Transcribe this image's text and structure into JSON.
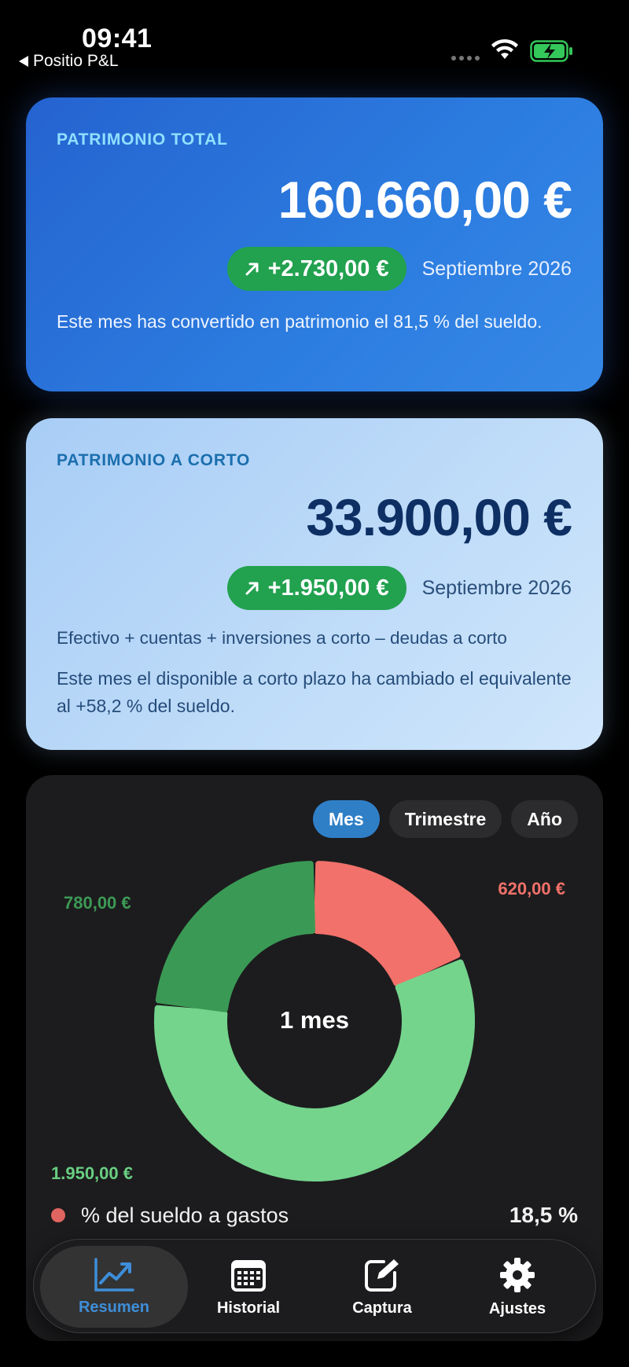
{
  "status": {
    "time": "09:41",
    "back_app": "Positio P&L"
  },
  "total": {
    "label": "PATRIMONIO TOTAL",
    "amount": "160.660,00 €",
    "delta": "+2.730,00 €",
    "period": "Septiembre 2026",
    "note": "Este mes has convertido en patrimonio el 81,5 % del sueldo."
  },
  "short": {
    "label": "PATRIMONIO A CORTO",
    "amount": "33.900,00 €",
    "delta": "+1.950,00 €",
    "period": "Septiembre 2026",
    "formula": "Efectivo + cuentas + inversiones a corto – deudas a corto",
    "note": "Este mes el disponible a corto plazo ha cambiado el equivalente al +58,2 % del sueldo."
  },
  "chart": {
    "segments": [
      "Mes",
      "Trimestre",
      "Año"
    ],
    "selected": "Mes",
    "center_label": "1 mes",
    "slices": [
      {
        "label": "620,00 €",
        "value": 620,
        "color": "#f2716a"
      },
      {
        "label": "1.950,00 €",
        "value": 1950,
        "color": "#74d48c"
      },
      {
        "label": "780,00 €",
        "value": 780,
        "color": "#3a9a55"
      }
    ],
    "legend": {
      "label": "% del sueldo a gastos",
      "value": "18,5 %",
      "color": "#e0645f"
    }
  },
  "tabs": [
    {
      "label": "Resumen",
      "icon": "chart-line-icon",
      "active": true
    },
    {
      "label": "Historial",
      "icon": "calendar-icon",
      "active": false
    },
    {
      "label": "Captura",
      "icon": "edit-icon",
      "active": false
    },
    {
      "label": "Ajustes",
      "icon": "gear-icon",
      "active": false
    }
  ]
}
